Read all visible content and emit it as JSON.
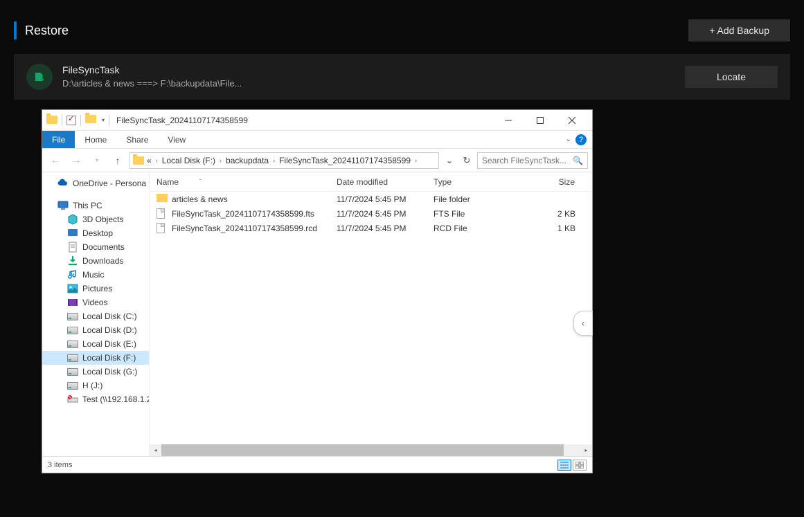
{
  "header": {
    "title": "Restore",
    "add_backup": "+ Add Backup"
  },
  "task": {
    "name": "FileSyncTask",
    "path": "D:\\articles & news ===> F:\\backupdata\\File...",
    "locate": "Locate"
  },
  "explorer": {
    "title": "FileSyncTask_20241107174358599",
    "ribbon": [
      "File",
      "Home",
      "Share",
      "View"
    ],
    "breadcrumb": {
      "prefix": "«",
      "segments": [
        "Local Disk (F:)",
        "backupdata",
        "FileSyncTask_20241107174358599"
      ]
    },
    "search_placeholder": "Search FileSyncTask...",
    "nav": [
      {
        "label": "OneDrive - Persona",
        "level": 1,
        "icon": "onedrive",
        "space_after": true
      },
      {
        "label": "This PC",
        "level": 1,
        "icon": "thispc"
      },
      {
        "label": "3D Objects",
        "level": 2,
        "icon": "3d"
      },
      {
        "label": "Desktop",
        "level": 2,
        "icon": "desktop"
      },
      {
        "label": "Documents",
        "level": 2,
        "icon": "docs"
      },
      {
        "label": "Downloads",
        "level": 2,
        "icon": "downloads"
      },
      {
        "label": "Music",
        "level": 2,
        "icon": "music"
      },
      {
        "label": "Pictures",
        "level": 2,
        "icon": "pictures"
      },
      {
        "label": "Videos",
        "level": 2,
        "icon": "videos"
      },
      {
        "label": "Local Disk (C:)",
        "level": 2,
        "icon": "disk"
      },
      {
        "label": "Local Disk (D:)",
        "level": 2,
        "icon": "disk"
      },
      {
        "label": "Local Disk (E:)",
        "level": 2,
        "icon": "disk"
      },
      {
        "label": "Local Disk (F:)",
        "level": 2,
        "icon": "disk",
        "selected": true
      },
      {
        "label": "Local Disk (G:)",
        "level": 2,
        "icon": "disk"
      },
      {
        "label": "H (J:)",
        "level": 2,
        "icon": "disk"
      },
      {
        "label": "Test (\\\\192.168.1.2",
        "level": 2,
        "icon": "netoff"
      }
    ],
    "columns": {
      "name": "Name",
      "date": "Date modified",
      "type": "Type",
      "size": "Size"
    },
    "rows": [
      {
        "name": "articles & news",
        "date": "11/7/2024 5:45 PM",
        "type": "File folder",
        "size": "",
        "icon": "folder"
      },
      {
        "name": "FileSyncTask_20241107174358599.fts",
        "date": "11/7/2024 5:45 PM",
        "type": "FTS File",
        "size": "2 KB",
        "icon": "doc"
      },
      {
        "name": "FileSyncTask_20241107174358599.rcd",
        "date": "11/7/2024 5:45 PM",
        "type": "RCD File",
        "size": "1 KB",
        "icon": "doc"
      }
    ],
    "status": "3 items"
  }
}
